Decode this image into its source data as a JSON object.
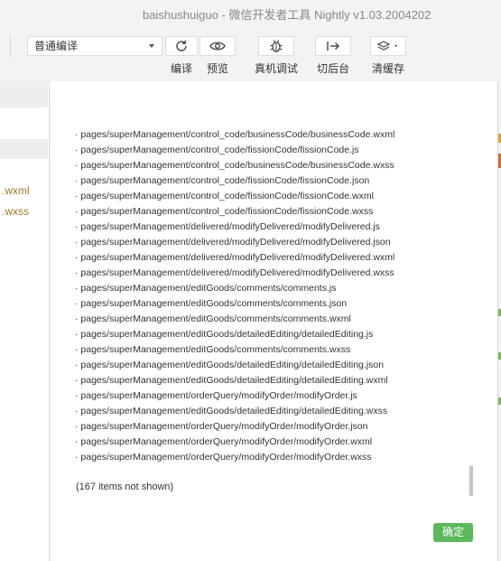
{
  "window": {
    "title": "baishushuiguo - 微信开发者工具 Nightly v1.03.2004202"
  },
  "toolbar": {
    "compile_mode": "普通编译",
    "buttons": [
      {
        "label": "编译",
        "icon": "refresh-icon"
      },
      {
        "label": "预览",
        "icon": "eye-icon"
      },
      {
        "label": "真机调试",
        "icon": "bug-icon"
      },
      {
        "label": "切后台",
        "icon": "switch-background-icon"
      },
      {
        "label": "清缓存",
        "icon": "layers-icon"
      }
    ]
  },
  "left_pane": {
    "files": [
      ".wxml",
      ".wxss"
    ]
  },
  "dialog": {
    "items": [
      "· pages/superManagement/control_code/businessCode/businessCode.wxml",
      "· pages/superManagement/control_code/fissionCode/fissionCode.js",
      "· pages/superManagement/control_code/businessCode/businessCode.wxss",
      "· pages/superManagement/control_code/fissionCode/fissionCode.json",
      "· pages/superManagement/control_code/fissionCode/fissionCode.wxml",
      "· pages/superManagement/control_code/fissionCode/fissionCode.wxss",
      "· pages/superManagement/delivered/modifyDelivered/modifyDelivered.js",
      "· pages/superManagement/delivered/modifyDelivered/modifyDelivered.json",
      "· pages/superManagement/delivered/modifyDelivered/modifyDelivered.wxml",
      "· pages/superManagement/delivered/modifyDelivered/modifyDelivered.wxss",
      "· pages/superManagement/editGoods/comments/comments.js",
      "· pages/superManagement/editGoods/comments/comments.json",
      "· pages/superManagement/editGoods/comments/comments.wxml",
      "· pages/superManagement/editGoods/detailedEditing/detailedEditing.js",
      "· pages/superManagement/editGoods/comments/comments.wxss",
      "· pages/superManagement/editGoods/detailedEditing/detailedEditing.json",
      "· pages/superManagement/editGoods/detailedEditing/detailedEditing.wxml",
      "· pages/superManagement/orderQuery/modifyOrder/modifyOrder.js",
      "· pages/superManagement/editGoods/detailedEditing/detailedEditing.wxss",
      "· pages/superManagement/orderQuery/modifyOrder/modifyOrder.json",
      "· pages/superManagement/orderQuery/modifyOrder/modifyOrder.wxml",
      "· pages/superManagement/orderQuery/modifyOrder/modifyOrder.wxss"
    ],
    "not_shown": "(167 items not shown)",
    "ok_label": "确定"
  },
  "colors": {
    "ok_button": "#5cb85c",
    "file_text": "#a0772a"
  }
}
